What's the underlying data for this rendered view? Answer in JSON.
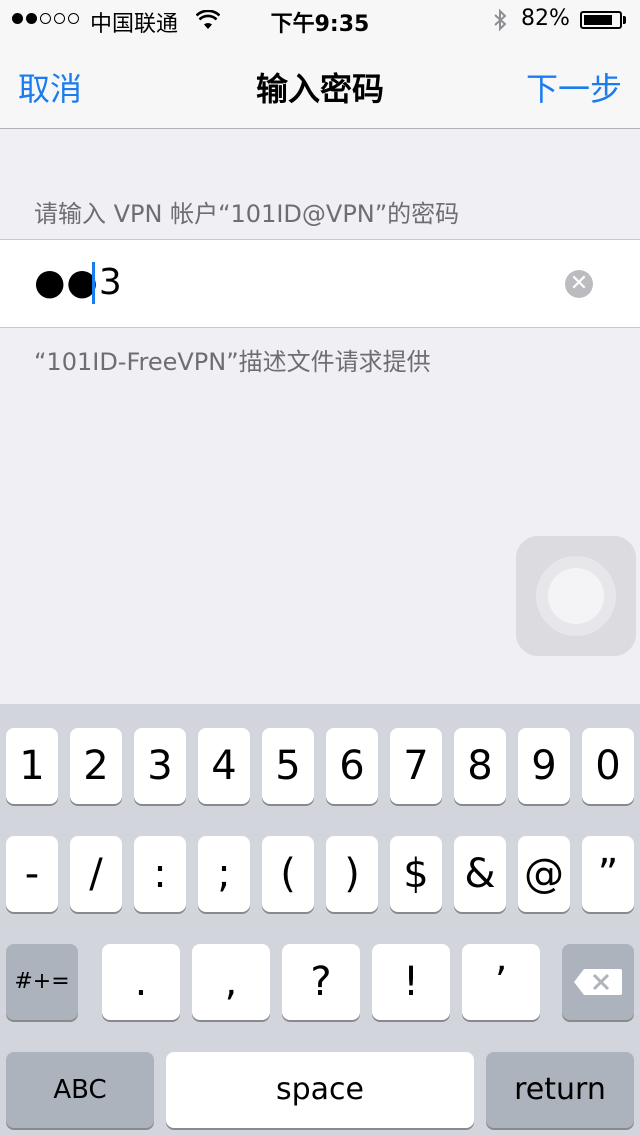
{
  "status_bar": {
    "carrier": "中国联通",
    "time": "下午9:35",
    "battery_percent": "82%",
    "battery_level": 0.82,
    "signal_bars_filled": 2,
    "signal_bars_total": 5,
    "icons": [
      "wifi-icon",
      "bluetooth-icon",
      "battery-icon"
    ]
  },
  "nav": {
    "cancel": "取消",
    "title": "输入密码",
    "next": "下一步"
  },
  "prompt": "请输入 VPN 帐户“101ID@VPN”的密码",
  "password_field": {
    "value": "●●3",
    "clear_icon": "clear-icon"
  },
  "footnote": "“101ID-FreeVPN”描述文件请求提供",
  "keyboard": {
    "row1": [
      "1",
      "2",
      "3",
      "4",
      "5",
      "6",
      "7",
      "8",
      "9",
      "0"
    ],
    "row2": [
      "-",
      "/",
      ":",
      ";",
      "(",
      ")",
      "$",
      "&",
      "@",
      "”"
    ],
    "row3_left": "#+=",
    "row3": [
      ".",
      ",",
      "?",
      "!",
      "’"
    ],
    "row3_right_icon": "backspace-icon",
    "abc": "ABC",
    "space": "space",
    "return": "return"
  },
  "colors": {
    "accent": "#1a7cf0",
    "background": "#efeff4",
    "keyboard_bg": "#d2d5db"
  }
}
